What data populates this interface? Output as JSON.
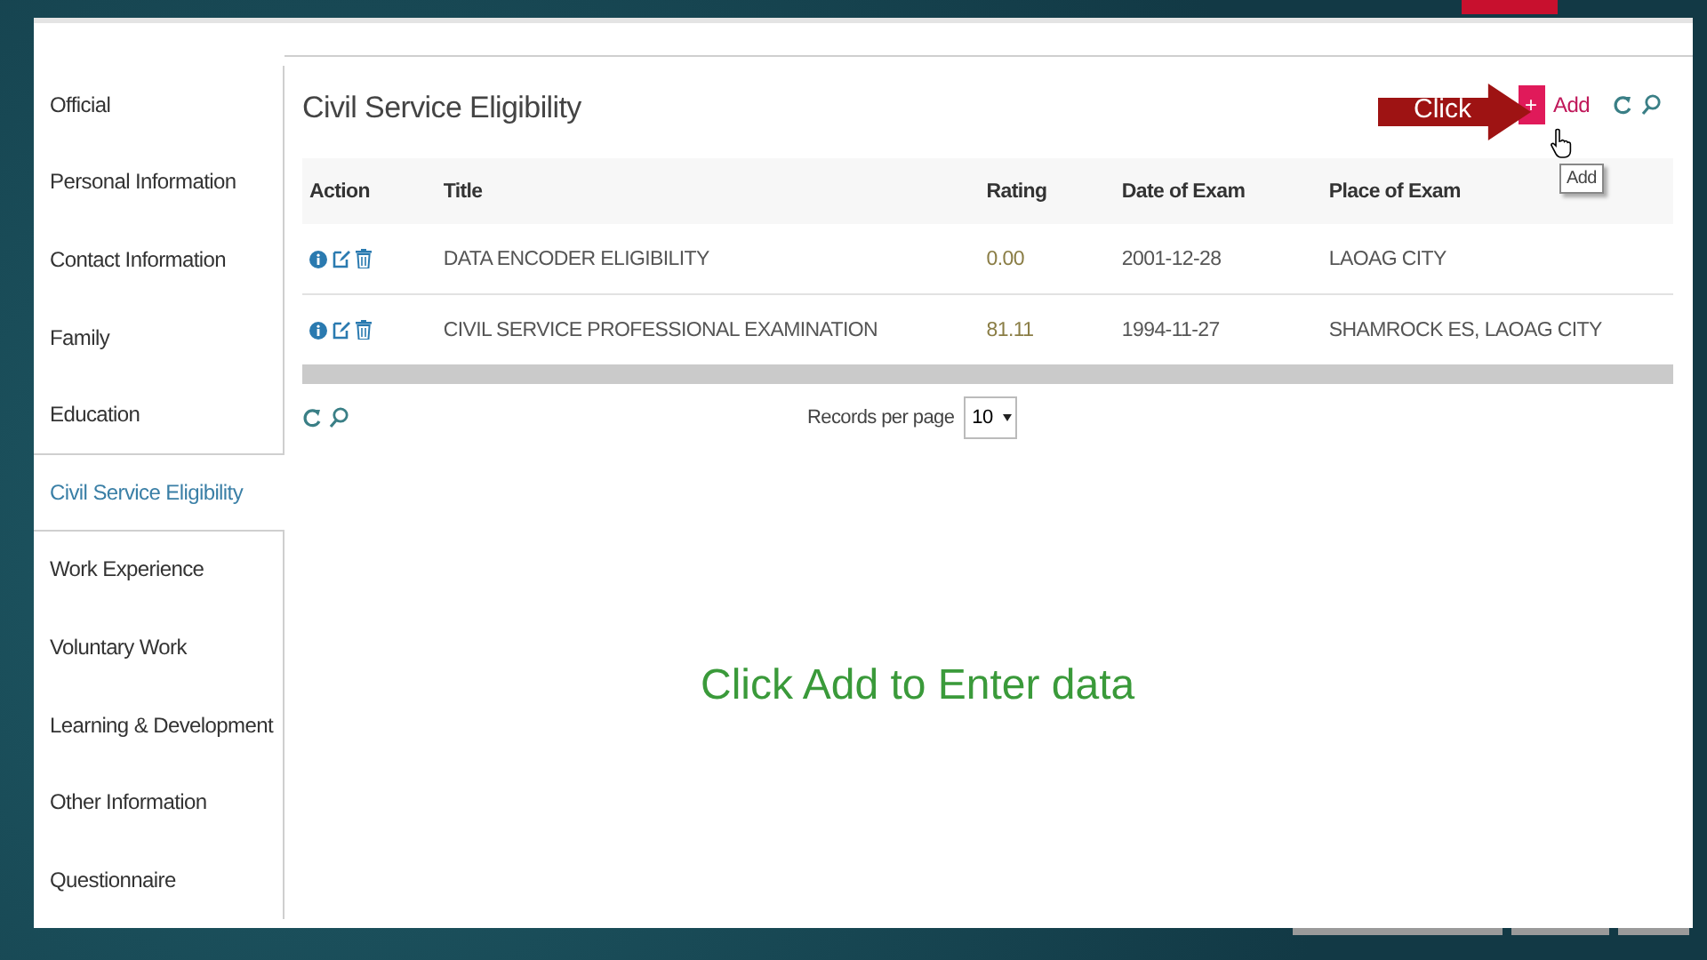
{
  "sidebar": {
    "items": [
      {
        "label": "Official",
        "selected": false
      },
      {
        "label": "Personal Information",
        "selected": false
      },
      {
        "label": "Contact Information",
        "selected": false
      },
      {
        "label": "Family",
        "selected": false
      },
      {
        "label": "Education",
        "selected": false
      },
      {
        "label": "Civil Service Eligibility",
        "selected": true
      },
      {
        "label": "Work Experience",
        "selected": false
      },
      {
        "label": "Voluntary Work",
        "selected": false
      },
      {
        "label": "Learning & Development",
        "selected": false
      },
      {
        "label": "Other Information",
        "selected": false
      },
      {
        "label": "Questionnaire",
        "selected": false
      }
    ]
  },
  "panel": {
    "title": "Civil Service Eligibility",
    "callout": "Click",
    "add_button": {
      "icon": "+",
      "label": "Add"
    },
    "tooltip": "Add",
    "table": {
      "columns": [
        "Action",
        "Title",
        "Rating",
        "Date of Exam",
        "Place of Exam"
      ],
      "rows": [
        {
          "title": "DATA ENCODER ELIGIBILITY",
          "rating": "0.00",
          "date_of_exam": "2001-12-28",
          "place_of_exam": "LAOAG CITY"
        },
        {
          "title": "CIVIL SERVICE PROFESSIONAL EXAMINATION",
          "rating": "81.11",
          "date_of_exam": "1994-11-27",
          "place_of_exam": "SHAMROCK ES, LAOAG CITY"
        }
      ]
    },
    "records_per_page": {
      "label": "Records per page",
      "value": "10"
    }
  },
  "caption": "Click Add to Enter data"
}
